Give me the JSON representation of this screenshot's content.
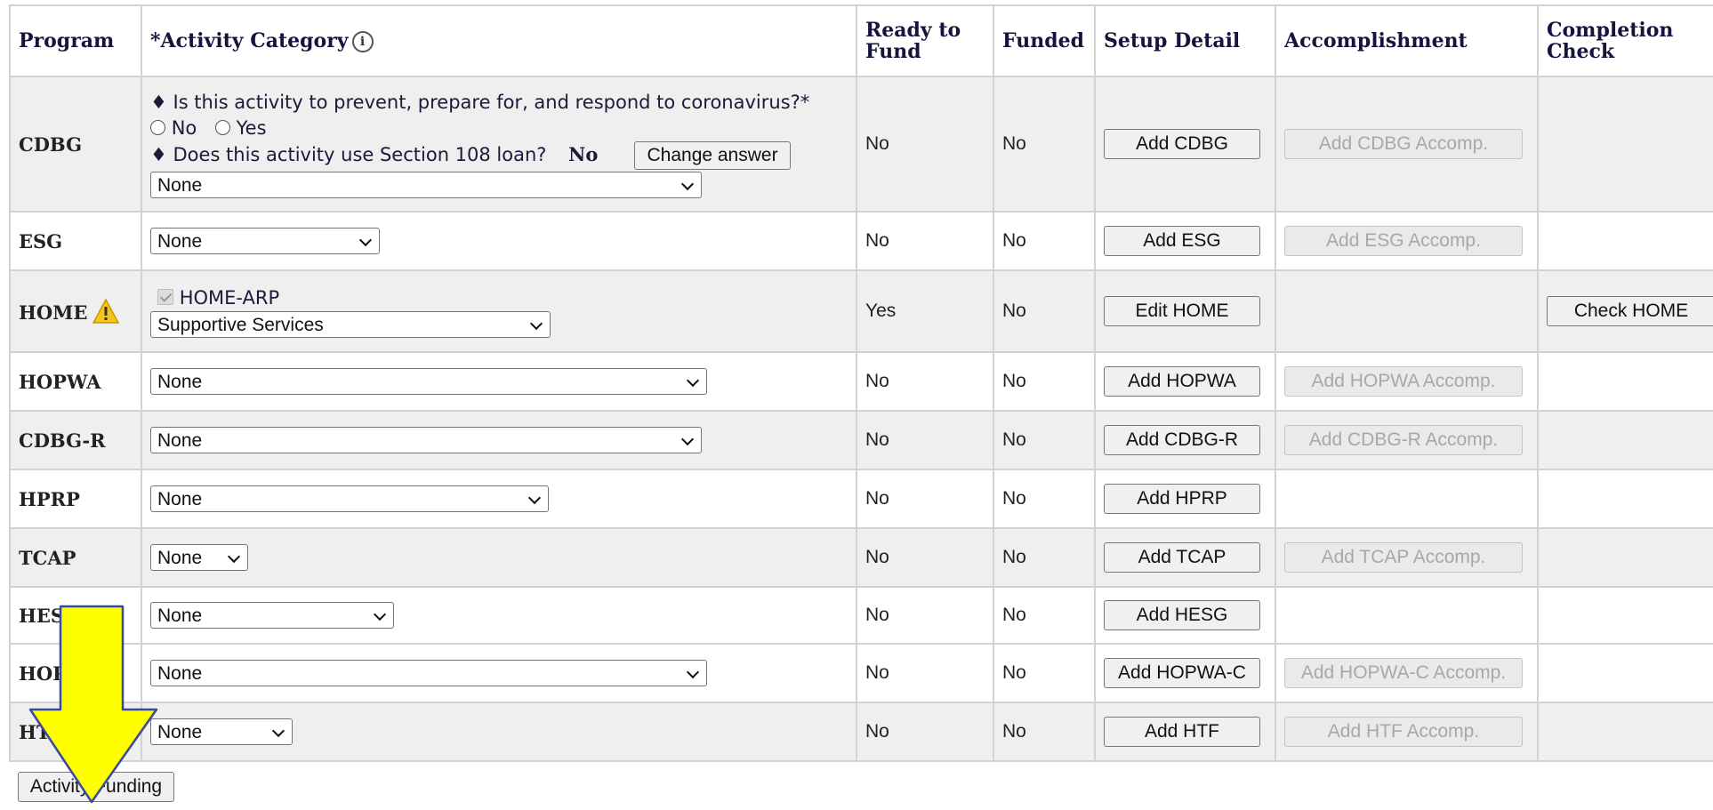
{
  "headers": {
    "program": "Program",
    "category": "*Activity Category",
    "ready": "Ready to Fund",
    "funded": "Funded",
    "setup": "Setup Detail",
    "accomp": "Accomplishment",
    "check": "Completion Check"
  },
  "cdbg_questions": {
    "q1": "♦ Is this activity to prevent, prepare for, and respond to coronavirus?*",
    "opt_no": "No",
    "opt_yes": "Yes",
    "q2": "♦ Does this activity use Section 108 loan?",
    "q2_answer": "No",
    "change_answer": "Change answer"
  },
  "home_arp_label": "HOME-ARP",
  "rows": [
    {
      "program": "CDBG",
      "category": "None",
      "ready": "No",
      "funded": "No",
      "setup": "Add CDBG",
      "accomp": "Add CDBG Accomp.",
      "check": ""
    },
    {
      "program": "ESG",
      "category": "None",
      "ready": "No",
      "funded": "No",
      "setup": "Add ESG",
      "accomp": "Add ESG Accomp.",
      "check": ""
    },
    {
      "program": "HOME",
      "category": "Supportive Services",
      "ready": "Yes",
      "funded": "No",
      "setup": "Edit HOME",
      "accomp": "",
      "check": "Check HOME"
    },
    {
      "program": "HOPWA",
      "category": "None",
      "ready": "No",
      "funded": "No",
      "setup": "Add HOPWA",
      "accomp": "Add HOPWA Accomp.",
      "check": ""
    },
    {
      "program": "CDBG-R",
      "category": "None",
      "ready": "No",
      "funded": "No",
      "setup": "Add CDBG-R",
      "accomp": "Add CDBG-R Accomp.",
      "check": ""
    },
    {
      "program": "HPRP",
      "category": "None",
      "ready": "No",
      "funded": "No",
      "setup": "Add HPRP",
      "accomp": "",
      "check": ""
    },
    {
      "program": "TCAP",
      "category": "None",
      "ready": "No",
      "funded": "No",
      "setup": "Add TCAP",
      "accomp": "Add TCAP Accomp.",
      "check": ""
    },
    {
      "program": "HES",
      "category": "None",
      "ready": "No",
      "funded": "No",
      "setup": "Add HESG",
      "accomp": "",
      "check": ""
    },
    {
      "program": "HOP",
      "category": "None",
      "ready": "No",
      "funded": "No",
      "setup": "Add HOPWA-C",
      "accomp": "Add HOPWA-C Accomp.",
      "check": ""
    },
    {
      "program": "HT",
      "category": "None",
      "ready": "No",
      "funded": "No",
      "setup": "Add HTF",
      "accomp": "Add HTF Accomp.",
      "check": ""
    }
  ],
  "footer": {
    "activity_funding": "Activity Funding"
  },
  "colors": {
    "arrow_fill": "#ffff00",
    "arrow_stroke": "#3a4a9a",
    "row_shade": "#efefef",
    "warning": "#f5c518"
  }
}
